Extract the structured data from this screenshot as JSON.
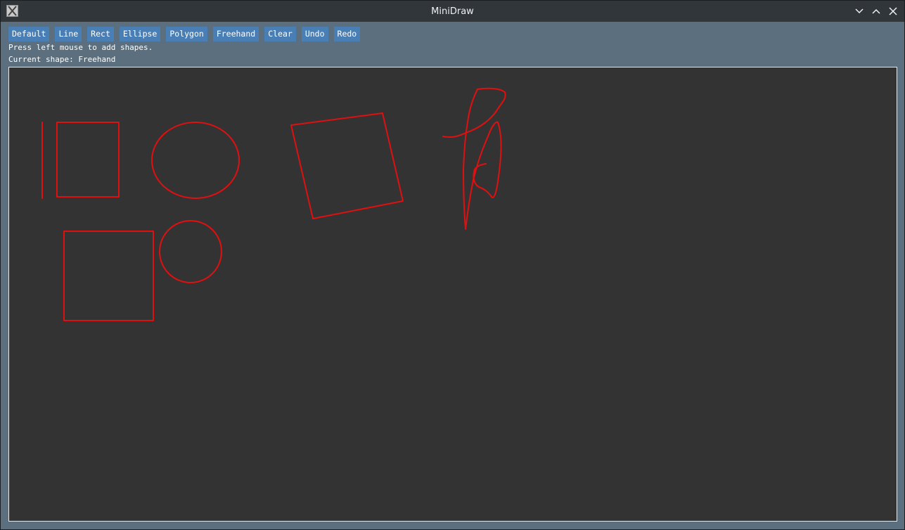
{
  "window": {
    "title": "MiniDraw",
    "icon": "x11-app-icon"
  },
  "toolbar": {
    "buttons": [
      "Default",
      "Line",
      "Rect",
      "Ellipse",
      "Polygon",
      "Freehand",
      "Clear",
      "Undo",
      "Redo"
    ]
  },
  "status": {
    "hint": "Press left mouse to add shapes.",
    "current_shape": "Current shape: Freehand"
  },
  "canvas": {
    "background": "#333333",
    "stroke_color": "#e01010",
    "shapes": [
      "line",
      "rect",
      "ellipse",
      "polygon",
      "freehand",
      "rect",
      "ellipse"
    ]
  },
  "colors": {
    "titlebar": "#31363b",
    "menubar": "#5b6f7e",
    "button": "#4a7fb5"
  }
}
